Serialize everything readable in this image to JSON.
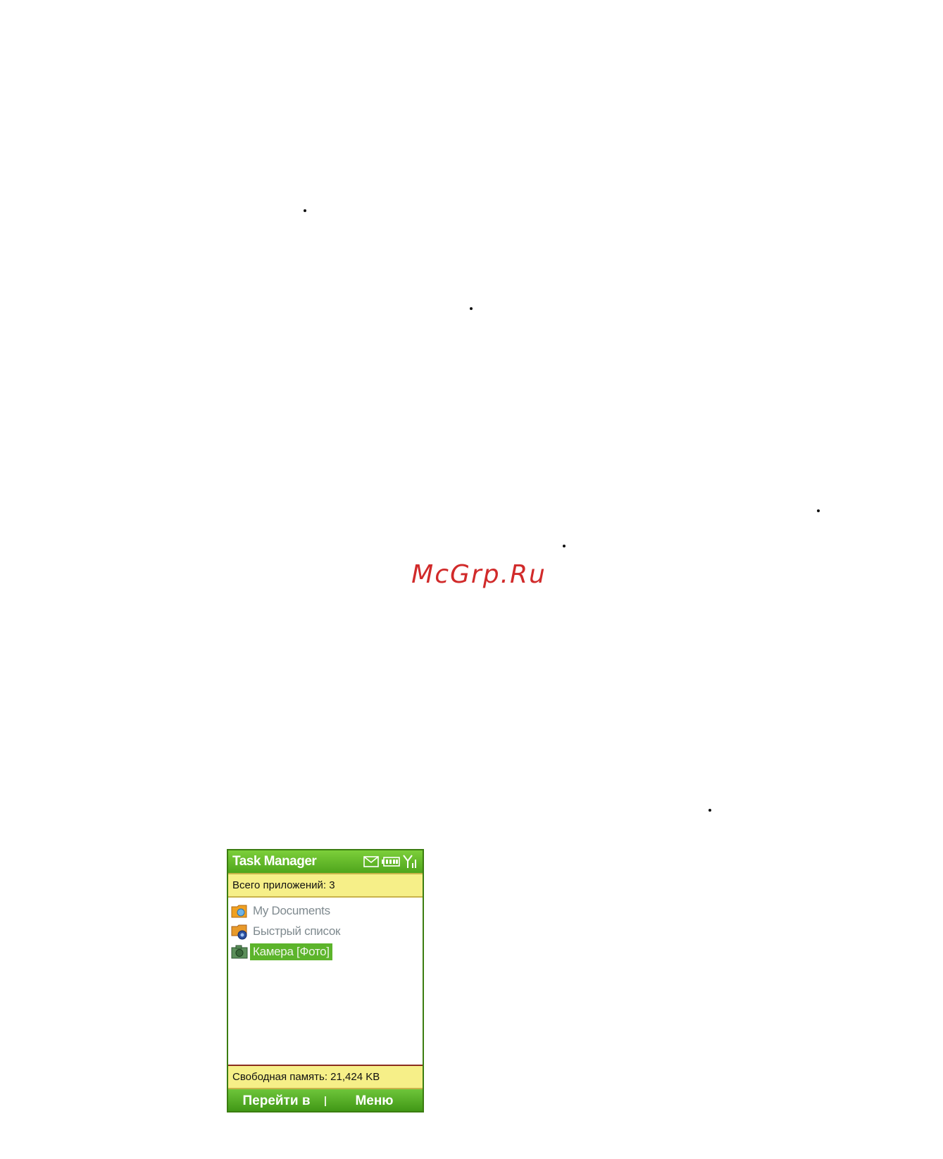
{
  "watermark": "McGrp.Ru",
  "phone": {
    "title": "Task Manager",
    "status_icons": [
      "envelope-icon",
      "battery-icon",
      "signal-icon"
    ],
    "apps_count": "Всего приложений: 3",
    "items": [
      {
        "label": "My Documents",
        "icon": "folder-icon",
        "selected": false
      },
      {
        "label": "Быстрый список",
        "icon": "quicklist-icon",
        "selected": false
      },
      {
        "label": "Камера [Фото]",
        "icon": "camera-icon",
        "selected": true
      }
    ],
    "free_memory": "Свободная память: 21,424 KB",
    "softkeys": {
      "left": "Перейти в",
      "right": "Меню"
    },
    "colors": {
      "accent": "#5cb42b",
      "infobar": "#f6ef88"
    }
  }
}
